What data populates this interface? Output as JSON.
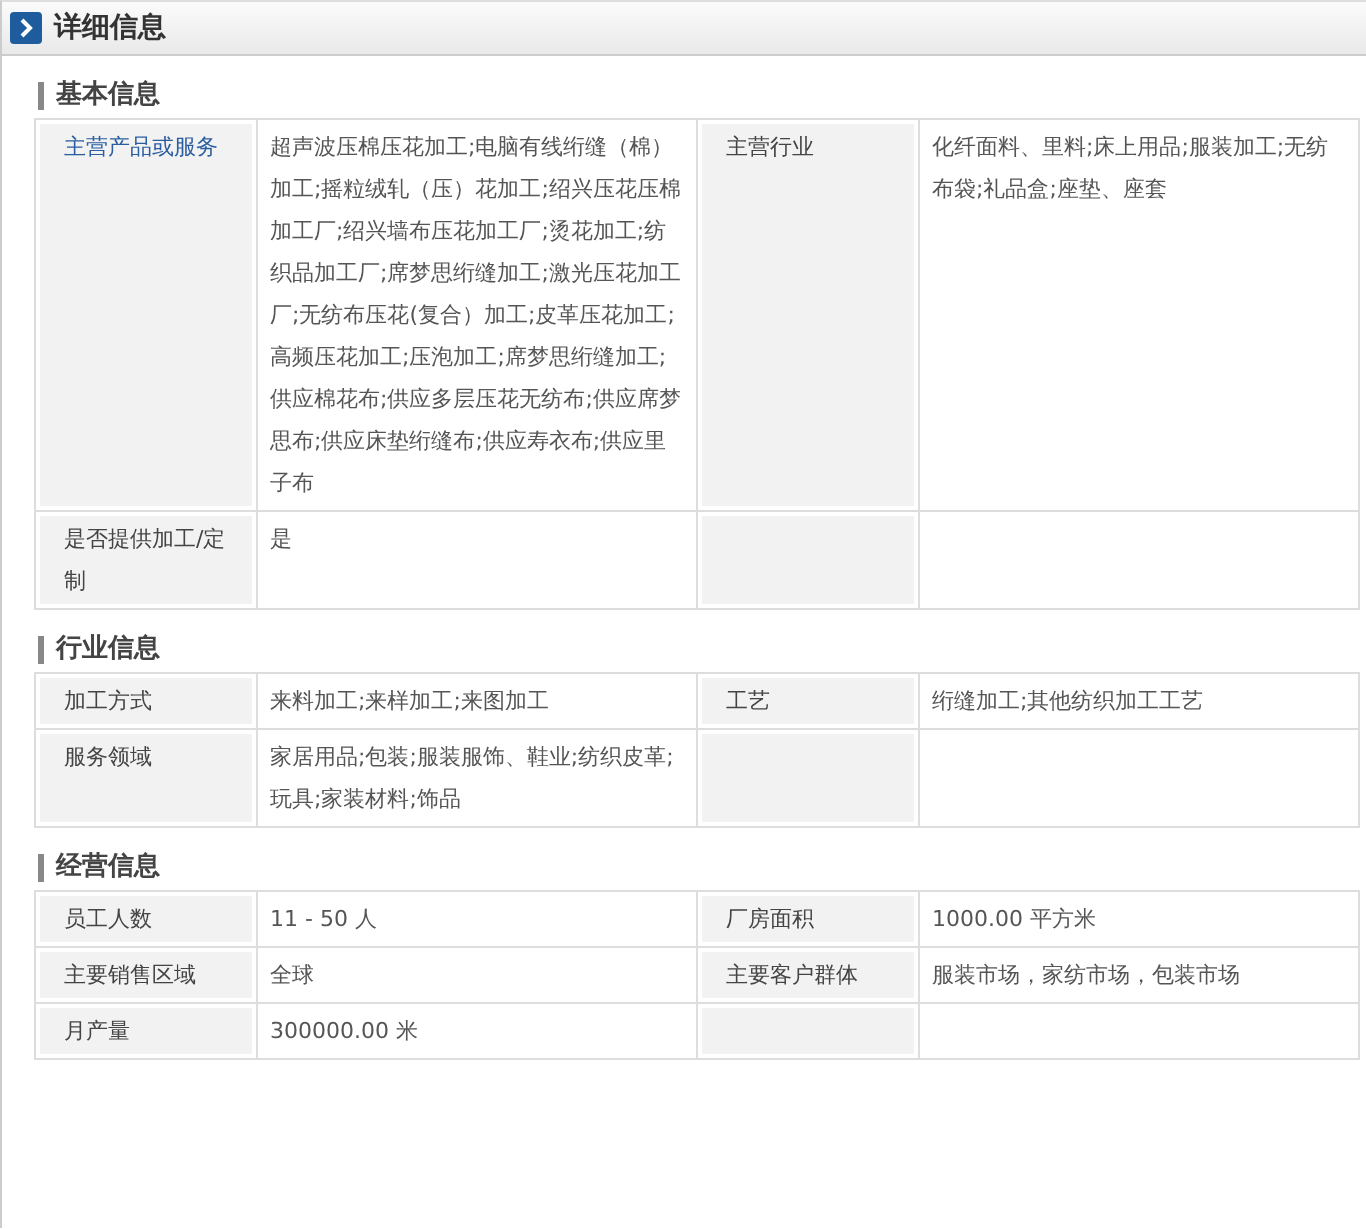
{
  "panel": {
    "title": "详细信息"
  },
  "sections": [
    {
      "title": "基本信息",
      "rows": [
        {
          "fields": [
            {
              "label": "主营产品或服务",
              "kind": "link",
              "value": "超声波压棉压花加工;电脑有线绗缝（棉）加工;摇粒绒轧（压）花加工;绍兴压花压棉加工厂;绍兴墙布压花加工厂;烫花加工;纺织品加工厂;席梦思绗缝加工;激光压花加工厂;无纺布压花(复合）加工;皮革压花加工;高频压花加工;压泡加工;席梦思绗缝加工;供应棉花布;供应多层压花无纺布;供应席梦思布;供应床垫绗缝布;供应寿衣布;供应里子布"
            },
            {
              "label": "主营行业",
              "kind": "plain",
              "value": "化纤面料、里料;床上用品;服装加工;无纺布袋;礼品盒;座垫、座套"
            }
          ]
        },
        {
          "fields": [
            {
              "label": "是否提供加工/定制",
              "kind": "plain",
              "value": "是"
            }
          ]
        }
      ]
    },
    {
      "title": "行业信息",
      "rows": [
        {
          "fields": [
            {
              "label": "加工方式",
              "kind": "plain",
              "value": "来料加工;来样加工;来图加工"
            },
            {
              "label": "工艺",
              "kind": "plain",
              "value": "绗缝加工;其他纺织加工工艺"
            }
          ]
        },
        {
          "fields": [
            {
              "label": "服务领域",
              "kind": "plain",
              "value": "家居用品;包装;服装服饰、鞋业;纺织皮革;玩具;家装材料;饰品"
            }
          ]
        }
      ]
    },
    {
      "title": "经营信息",
      "rows": [
        {
          "fields": [
            {
              "label": "员工人数",
              "kind": "plain",
              "value": "11 - 50 人"
            },
            {
              "label": "厂房面积",
              "kind": "plain",
              "value": "1000.00 平方米"
            }
          ]
        },
        {
          "fields": [
            {
              "label": "主要销售区域",
              "kind": "plain",
              "value": "全球"
            },
            {
              "label": "主要客户群体",
              "kind": "plain",
              "value": "服装市场，家纺市场，包装市场"
            }
          ]
        },
        {
          "fields": [
            {
              "label": "月产量",
              "kind": "plain",
              "value": "300000.00 米"
            }
          ]
        }
      ]
    }
  ]
}
